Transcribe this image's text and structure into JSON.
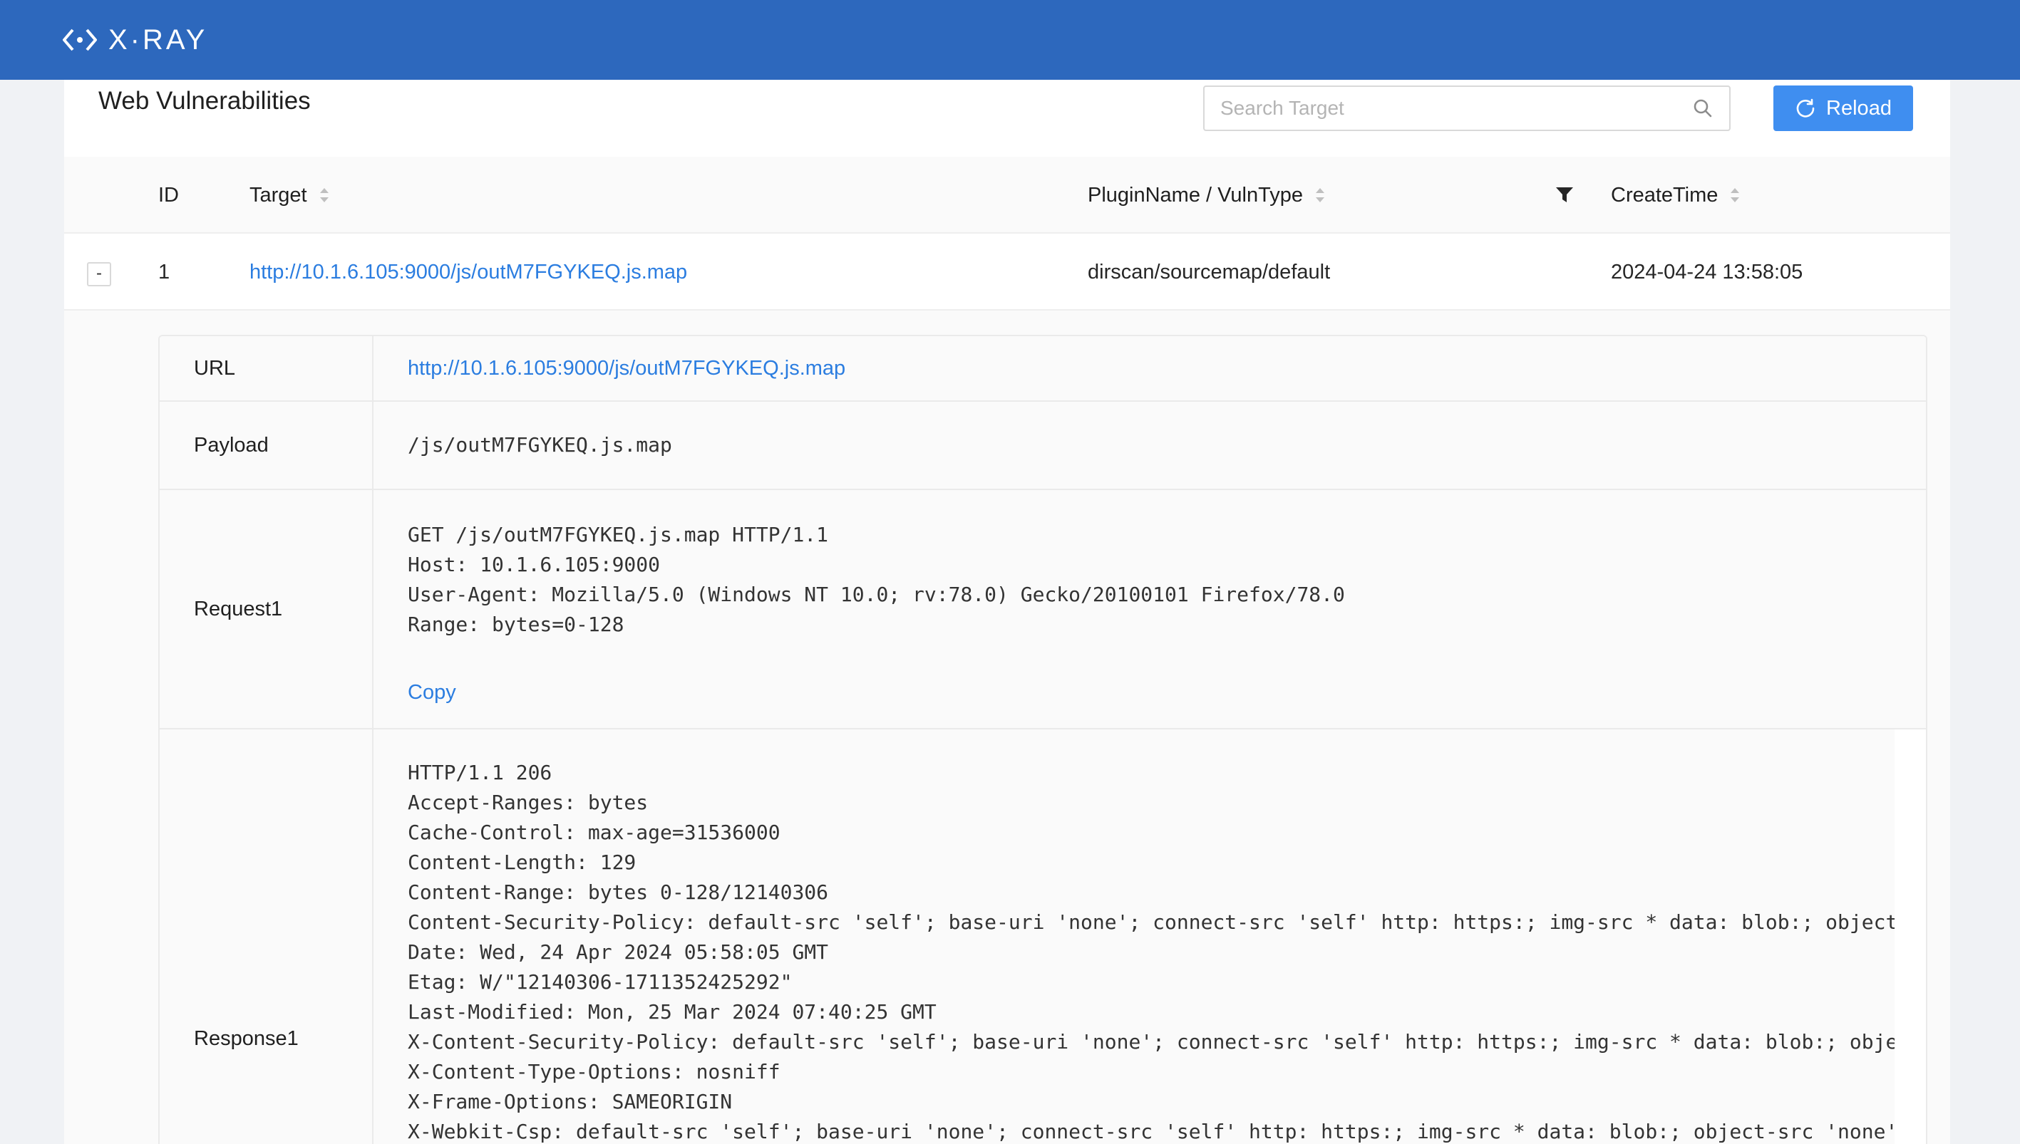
{
  "app": {
    "brand": "X·RAY"
  },
  "page": {
    "title": "Web Vulnerabilities",
    "search_placeholder": "Search Target",
    "reload_label": "Reload"
  },
  "table": {
    "columns": {
      "id": "ID",
      "target": "Target",
      "plugin": "PluginName / VulnType",
      "createtime": "CreateTime"
    },
    "rows": [
      {
        "expand_symbol": "-",
        "id": "1",
        "target": "http://10.1.6.105:9000/js/outM7FGYKEQ.js.map",
        "plugin": "dirscan/sourcemap/default",
        "createtime": "2024-04-24 13:58:05"
      }
    ]
  },
  "detail": {
    "url_label": "URL",
    "url_value": "http://10.1.6.105:9000/js/outM7FGYKEQ.js.map",
    "payload_label": "Payload",
    "payload_value": "/js/outM7FGYKEQ.js.map",
    "request_label": "Request1",
    "request_lines": [
      "GET /js/outM7FGYKEQ.js.map HTTP/1.1",
      "Host: 10.1.6.105:9000",
      "User-Agent: Mozilla/5.0 (Windows NT 10.0; rv:78.0) Gecko/20100101 Firefox/78.0",
      "Range: bytes=0-128"
    ],
    "copy_label": "Copy",
    "response_label": "Response1",
    "response_lines": [
      "HTTP/1.1 206",
      "Accept-Ranges: bytes",
      "Cache-Control: max-age=31536000",
      "Content-Length: 129",
      "Content-Range: bytes 0-128/12140306",
      "Content-Security-Policy: default-src 'self'; base-uri 'none'; connect-src 'self' http: https:; img-src * data: blob:; object",
      "Date: Wed, 24 Apr 2024 05:58:05 GMT",
      "Etag: W/\"12140306-1711352425292\"",
      "Last-Modified: Mon, 25 Mar 2024 07:40:25 GMT",
      "X-Content-Security-Policy: default-src 'self'; base-uri 'none'; connect-src 'self' http: https:; img-src * data: blob:; obje",
      "X-Content-Type-Options: nosniff",
      "X-Frame-Options: SAMEORIGIN",
      "X-Webkit-Csp: default-src 'self'; base-uri 'none'; connect-src 'self' http: https:; img-src * data: blob:; object-src 'none'"
    ]
  },
  "colors": {
    "header": "#2d68bd",
    "primary": "#3f8ef0",
    "link": "#2b7de0"
  }
}
